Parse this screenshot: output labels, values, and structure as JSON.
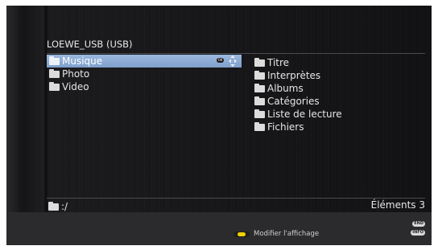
{
  "device_title": "LOEWE_USB (USB)",
  "left_list": [
    {
      "label": "Musique",
      "selected": true
    },
    {
      "label": "Photo",
      "selected": false
    },
    {
      "label": "Video",
      "selected": false
    }
  ],
  "right_list": [
    {
      "label": "Titre"
    },
    {
      "label": "Interprètes"
    },
    {
      "label": "Albums"
    },
    {
      "label": "Catégories"
    },
    {
      "label": "Liste de lecture"
    },
    {
      "label": "Fichiers"
    }
  ],
  "status": {
    "path": ":/",
    "count": "Éléments 3"
  },
  "footer": {
    "hint": "Modifier l'affichage",
    "end_key": "END",
    "info_key": "INFO"
  },
  "icons": {
    "ok": "ok-icon",
    "nav": "nav-arrows-icon",
    "folder": "folder-icon",
    "yellow_key": "yellow-key-icon"
  },
  "colors": {
    "selection": "#8fadd8",
    "yellow_key": "#f0d000"
  }
}
